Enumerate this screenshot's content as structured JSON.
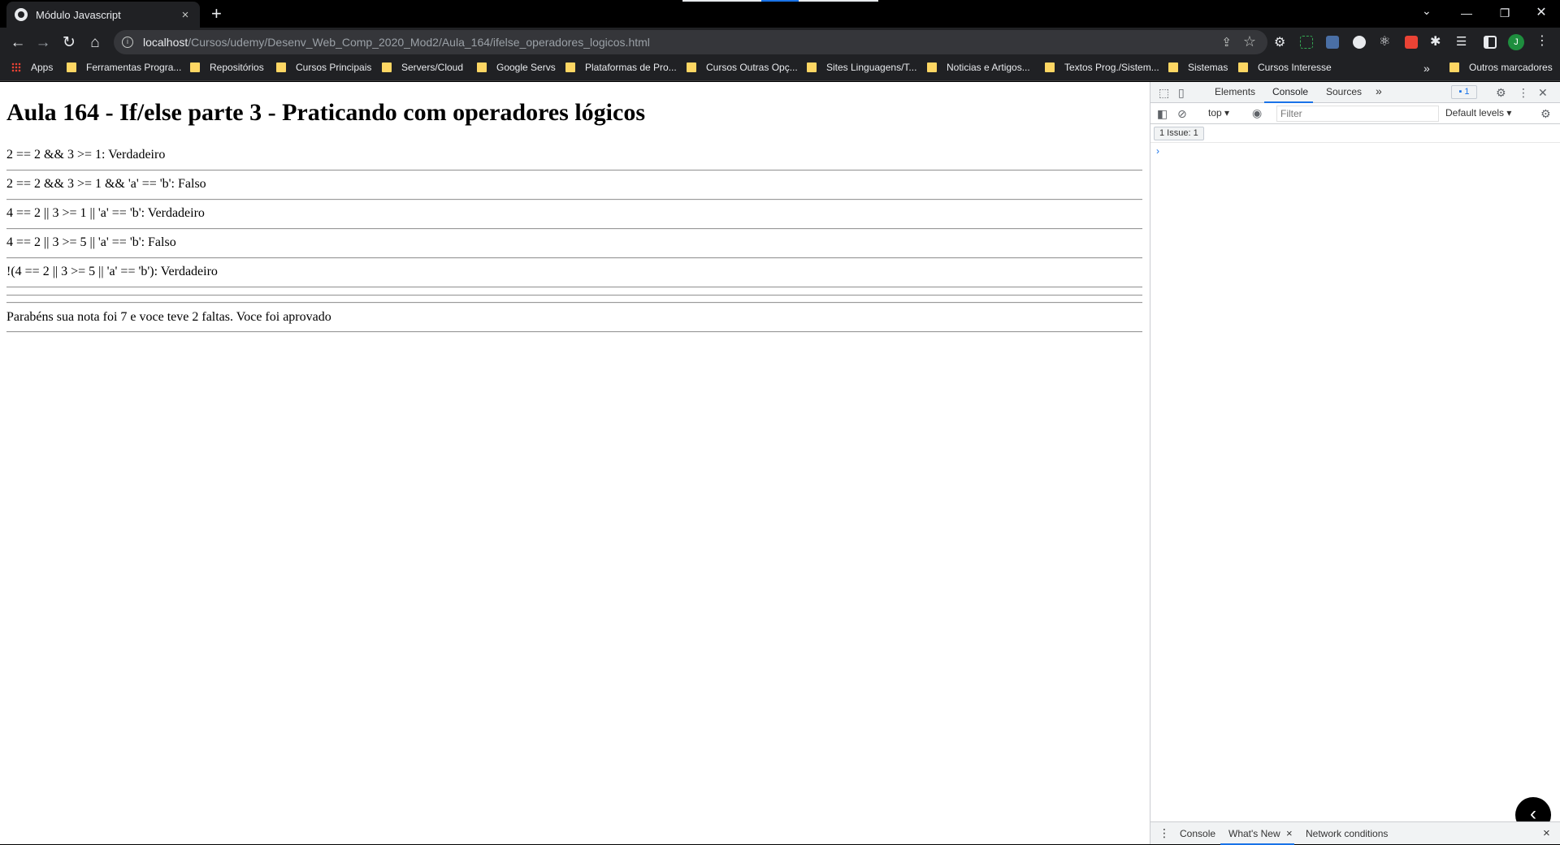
{
  "browser": {
    "tab_title": "Módulo Javascript",
    "tab_close": "×",
    "new_tab": "+",
    "url_host": "localhost",
    "url_path": "/Cursos/udemy/Desenv_Web_Comp_2020_Mod2/Aula_164/ifelse_operadores_logicos.html",
    "avatar_letter": "J",
    "bookmarks": [
      "Apps",
      "Ferramentas Progra...",
      "Repositórios",
      "Cursos Principais",
      "Servers/Cloud",
      "Google Servs",
      "Plataformas de Pro...",
      "Cursos Outras Opç...",
      "Sites Linguagens/T...",
      "Noticias e Artigos...",
      "Textos Prog./Sistem...",
      "Sistemas",
      "Cursos Interesse"
    ],
    "bookmarks_more": "»",
    "other_bookmarks": "Outros marcadores"
  },
  "page": {
    "heading": "Aula 164 - If/else parte 3 - Praticando com operadores lógicos",
    "lines": [
      "2 == 2 && 3 >= 1: Verdadeiro",
      "2 == 2 && 3 >= 1 && 'a' == 'b': Falso",
      "4 == 2 || 3 >= 1 || 'a' == 'b': Verdadeiro",
      "4 == 2 || 3 >= 5 || 'a' == 'b': Falso",
      "!(4 == 2 || 3 >= 5 || 'a' == 'b'): Verdadeiro"
    ],
    "result": "Parabéns sua nota foi 7 e voce teve 2 faltas. Voce foi aprovado"
  },
  "devtools": {
    "tabs": [
      "Elements",
      "Console",
      "Sources"
    ],
    "more_tabs": "»",
    "issue_badge": "1",
    "context": "top ▾",
    "filter_placeholder": "Filter",
    "levels": "Default levels ▾",
    "issues_chip": "1 Issue: 1",
    "prompt": "›",
    "drawer_tabs": [
      "Console",
      "What's New",
      "Network conditions"
    ],
    "drawer_whatsnew_close": "×",
    "drawer_close": "×"
  },
  "colors": {
    "chrome_bg": "#202124",
    "accent": "#1a73e8",
    "folder": "#fdd663"
  }
}
